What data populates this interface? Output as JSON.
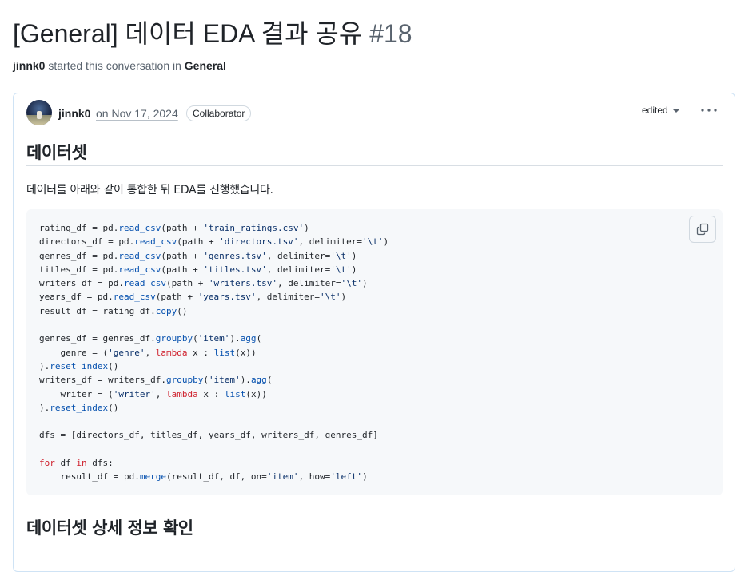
{
  "header": {
    "title": "[General] 데이터 EDA 결과 공유",
    "number": "#18",
    "byline_user": "jinnk0",
    "byline_text": " started this conversation in ",
    "byline_category": "General"
  },
  "post": {
    "author": "jinnk0",
    "date": "on Nov 17, 2024",
    "badge": "Collaborator",
    "edited_label": "edited"
  },
  "body": {
    "heading1": "데이터셋",
    "paragraph": "데이터를 아래와 같이 통합한 뒤 EDA를 진행했습니다.",
    "heading2": "데이터셋 상세 정보 확인",
    "code_lines": [
      [
        [
          "p",
          "rating_df = pd."
        ],
        [
          "f",
          "read_csv"
        ],
        [
          "p",
          "(path + "
        ],
        [
          "s",
          "'train_ratings.csv'"
        ],
        [
          "p",
          ")"
        ]
      ],
      [
        [
          "p",
          "directors_df = pd."
        ],
        [
          "f",
          "read_csv"
        ],
        [
          "p",
          "(path + "
        ],
        [
          "s",
          "'directors.tsv'"
        ],
        [
          "p",
          ", delimiter="
        ],
        [
          "s",
          "'\\t'"
        ],
        [
          "p",
          ")"
        ]
      ],
      [
        [
          "p",
          "genres_df = pd."
        ],
        [
          "f",
          "read_csv"
        ],
        [
          "p",
          "(path + "
        ],
        [
          "s",
          "'genres.tsv'"
        ],
        [
          "p",
          ", delimiter="
        ],
        [
          "s",
          "'\\t'"
        ],
        [
          "p",
          ")"
        ]
      ],
      [
        [
          "p",
          "titles_df = pd."
        ],
        [
          "f",
          "read_csv"
        ],
        [
          "p",
          "(path + "
        ],
        [
          "s",
          "'titles.tsv'"
        ],
        [
          "p",
          ", delimiter="
        ],
        [
          "s",
          "'\\t'"
        ],
        [
          "p",
          ")"
        ]
      ],
      [
        [
          "p",
          "writers_df = pd."
        ],
        [
          "f",
          "read_csv"
        ],
        [
          "p",
          "(path + "
        ],
        [
          "s",
          "'writers.tsv'"
        ],
        [
          "p",
          ", delimiter="
        ],
        [
          "s",
          "'\\t'"
        ],
        [
          "p",
          ")"
        ]
      ],
      [
        [
          "p",
          "years_df = pd."
        ],
        [
          "f",
          "read_csv"
        ],
        [
          "p",
          "(path + "
        ],
        [
          "s",
          "'years.tsv'"
        ],
        [
          "p",
          ", delimiter="
        ],
        [
          "s",
          "'\\t'"
        ],
        [
          "p",
          ")"
        ]
      ],
      [
        [
          "p",
          "result_df = rating_df."
        ],
        [
          "f",
          "copy"
        ],
        [
          "p",
          "()"
        ]
      ],
      [
        [
          "p",
          ""
        ]
      ],
      [
        [
          "p",
          "genres_df = genres_df."
        ],
        [
          "f",
          "groupby"
        ],
        [
          "p",
          "("
        ],
        [
          "s",
          "'item'"
        ],
        [
          "p",
          ")."
        ],
        [
          "f",
          "agg"
        ],
        [
          "p",
          "("
        ]
      ],
      [
        [
          "p",
          "    genre = ("
        ],
        [
          "s",
          "'genre'"
        ],
        [
          "p",
          ", "
        ],
        [
          "k",
          "lambda"
        ],
        [
          "p",
          " x : "
        ],
        [
          "f",
          "list"
        ],
        [
          "p",
          "(x))"
        ]
      ],
      [
        [
          "p",
          ")."
        ],
        [
          "f",
          "reset_index"
        ],
        [
          "p",
          "()"
        ]
      ],
      [
        [
          "p",
          "writers_df = writers_df."
        ],
        [
          "f",
          "groupby"
        ],
        [
          "p",
          "("
        ],
        [
          "s",
          "'item'"
        ],
        [
          "p",
          ")."
        ],
        [
          "f",
          "agg"
        ],
        [
          "p",
          "("
        ]
      ],
      [
        [
          "p",
          "    writer = ("
        ],
        [
          "s",
          "'writer'"
        ],
        [
          "p",
          ", "
        ],
        [
          "k",
          "lambda"
        ],
        [
          "p",
          " x : "
        ],
        [
          "f",
          "list"
        ],
        [
          "p",
          "(x))"
        ]
      ],
      [
        [
          "p",
          ")."
        ],
        [
          "f",
          "reset_index"
        ],
        [
          "p",
          "()"
        ]
      ],
      [
        [
          "p",
          ""
        ]
      ],
      [
        [
          "p",
          "dfs = [directors_df, titles_df, years_df, writers_df, genres_df]"
        ]
      ],
      [
        [
          "p",
          ""
        ]
      ],
      [
        [
          "k",
          "for"
        ],
        [
          "p",
          " df "
        ],
        [
          "k",
          "in"
        ],
        [
          "p",
          " dfs:"
        ]
      ],
      [
        [
          "p",
          "    result_df = pd."
        ],
        [
          "f",
          "merge"
        ],
        [
          "p",
          "(result_df, df, on="
        ],
        [
          "s",
          "'item'"
        ],
        [
          "p",
          ", how="
        ],
        [
          "s",
          "'left'"
        ],
        [
          "p",
          ")"
        ]
      ]
    ]
  }
}
